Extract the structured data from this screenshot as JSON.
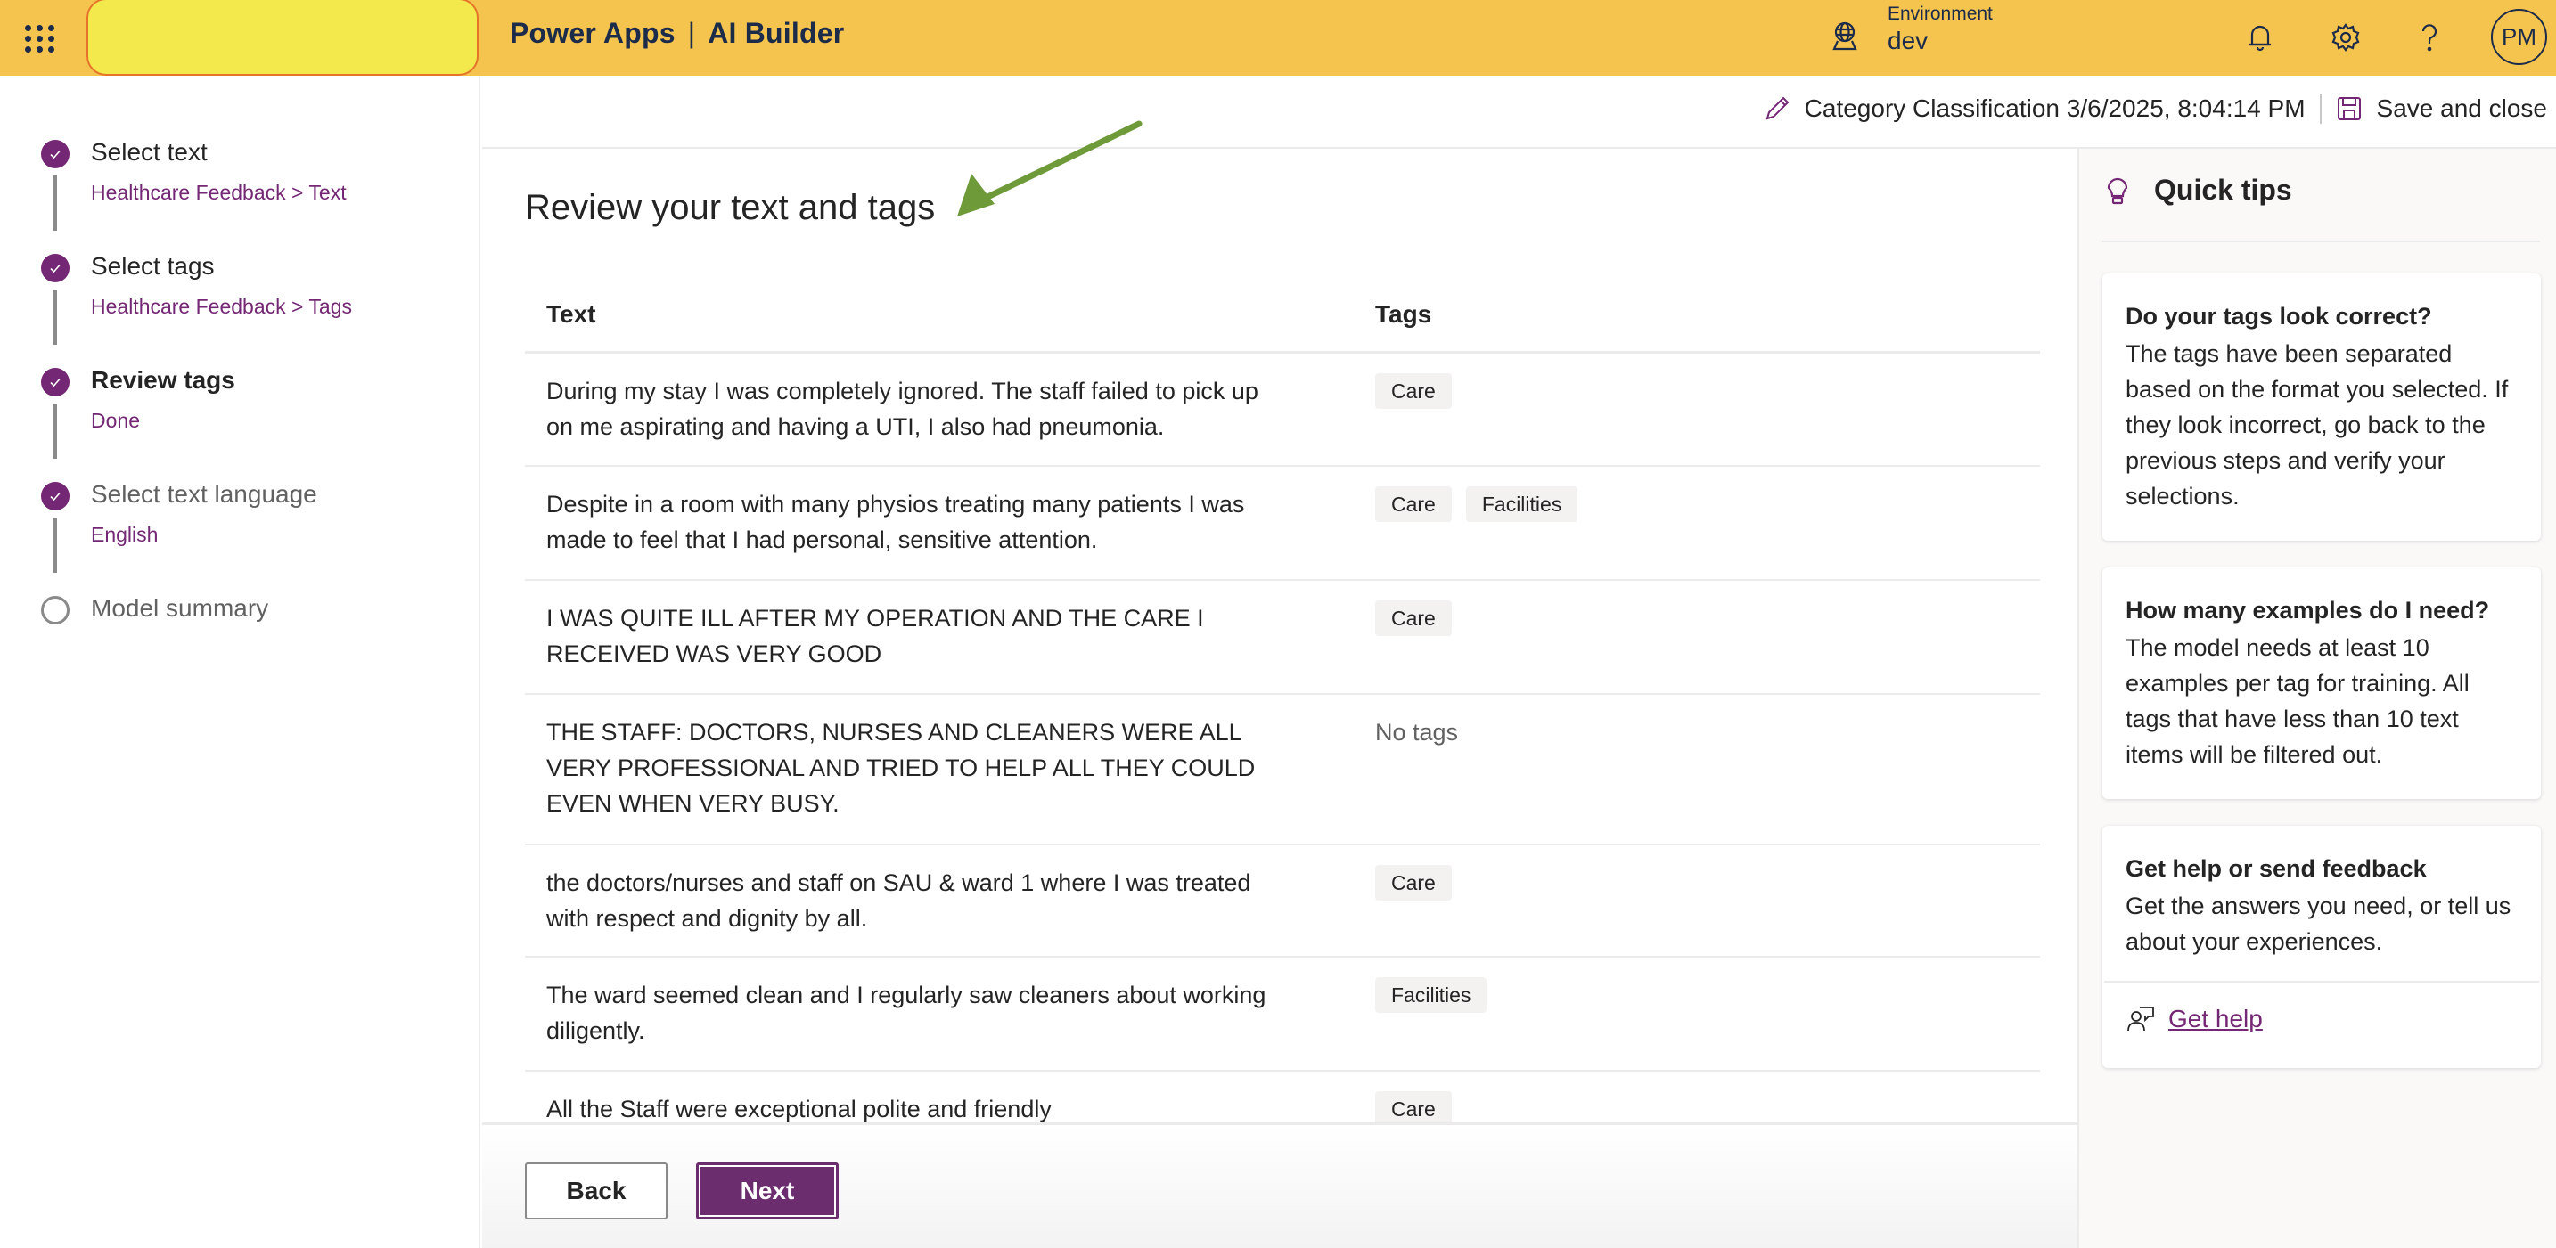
{
  "header": {
    "app_name": "Power Apps",
    "separator": "|",
    "product_name": "AI Builder",
    "environment_label": "Environment",
    "environment_value": "dev",
    "avatar_initials": "PM",
    "icons": [
      "waffle-icon",
      "environment-globe-icon",
      "bell-icon",
      "gear-icon",
      "help-icon"
    ]
  },
  "stepper": {
    "steps": [
      {
        "title": "Select text",
        "subtitle": "Healthcare Feedback > Text",
        "state": "complete"
      },
      {
        "title": "Select tags",
        "subtitle": "Healthcare Feedback > Tags",
        "state": "complete"
      },
      {
        "title": "Review tags",
        "subtitle": "Done",
        "state": "current"
      },
      {
        "title": "Select text language",
        "subtitle": "English",
        "state": "complete"
      },
      {
        "title": "Model summary",
        "subtitle": "",
        "state": "pending"
      }
    ]
  },
  "command_bar": {
    "model_name": "Category Classification 3/6/2025, 8:04:14 PM",
    "save_close_label": "Save and close"
  },
  "main": {
    "title": "Review your text and tags",
    "columns": {
      "text": "Text",
      "tags": "Tags"
    },
    "rows": [
      {
        "text": "During my stay I was completely ignored. The staff failed to pick up on me aspirating and having a UTI, I also had pneumonia.",
        "tags": [
          "Care"
        ]
      },
      {
        "text": "Despite in a room with many physios treating many patients I was made to feel that I had personal, sensitive attention.",
        "tags": [
          "Care",
          "Facilities"
        ]
      },
      {
        "text": "I WAS QUITE ILL AFTER MY OPERATION AND THE CARE I RECEIVED WAS VERY GOOD",
        "tags": [
          "Care"
        ]
      },
      {
        "text": "THE STAFF: DOCTORS, NURSES AND CLEANERS WERE ALL VERY PROFESSIONAL AND TRIED TO HELP ALL THEY COULD EVEN WHEN VERY BUSY.",
        "tags": []
      },
      {
        "text": "the doctors/nurses and staff on SAU & ward 1 where I was treated with respect and dignity by all.",
        "tags": [
          "Care"
        ]
      },
      {
        "text": "The ward seemed clean and I regularly saw cleaners about working diligently.",
        "tags": [
          "Facilities"
        ]
      },
      {
        "text": "All the Staff were exceptional polite and friendly",
        "tags": [
          "Care"
        ]
      }
    ],
    "no_tags_label": "No tags"
  },
  "footer": {
    "back_label": "Back",
    "next_label": "Next"
  },
  "quick_tips": {
    "title": "Quick tips",
    "cards": [
      {
        "title": "Do your tags look correct?",
        "body": "The tags have been separated based on the format you selected. If they look incorrect, go back to the previous steps and verify your selections."
      },
      {
        "title": "How many examples do I need?",
        "body": "The model needs at least 10 examples per tag for training. All tags that have less than 10 text items will be filtered out."
      },
      {
        "title": "Get help or send feedback",
        "body": "Get the answers you need, or tell us about your experiences.",
        "link_label": "Get help"
      }
    ]
  },
  "colors": {
    "header_bg": "#f4c44f",
    "header_text": "#1c2b4a",
    "brand_purple": "#742774",
    "next_button": "#6b2d6e",
    "annotation_arrow": "#6e9a3a",
    "annotation_highlight": "#f3e94c"
  }
}
